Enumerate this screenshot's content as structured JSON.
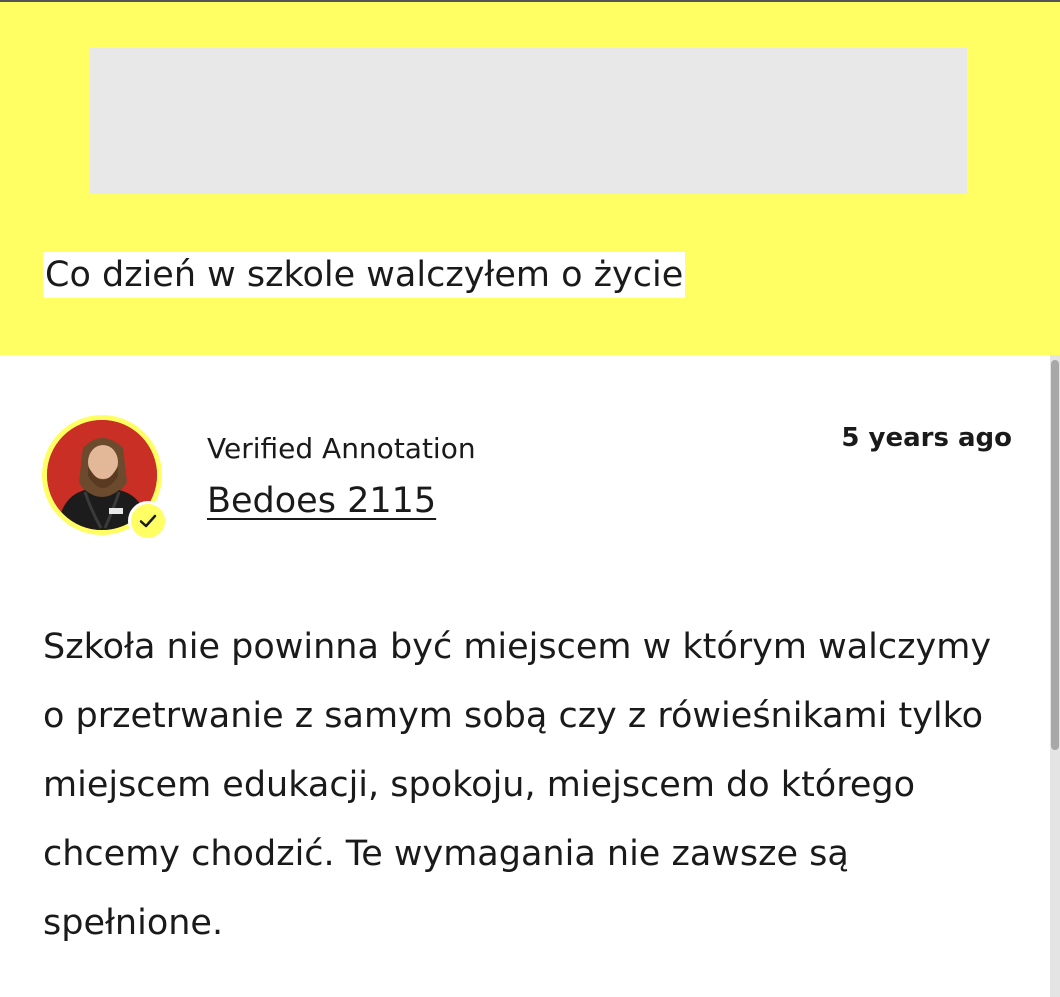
{
  "header": {
    "quote": "Co dzień w szkole walczyłem o życie",
    "background_color": "#ffff64",
    "ad_placeholder_color": "#e8e8e8"
  },
  "annotation": {
    "label": "Verified Annotation",
    "author": "Bedoes 2115",
    "timestamp": "5 years ago",
    "body": "Szkoła nie powinna być miejscem w którym walczymy o przetrwanie z samym sobą czy z rówieśnikami tylko miejscem edukacji, spokoju, miejscem do którego chcemy chodzić. Te wymagania nie zawsze są spełnione.",
    "avatar_icon": "user-avatar",
    "badge_icon": "check-icon",
    "badge_color": "#ffff64"
  }
}
